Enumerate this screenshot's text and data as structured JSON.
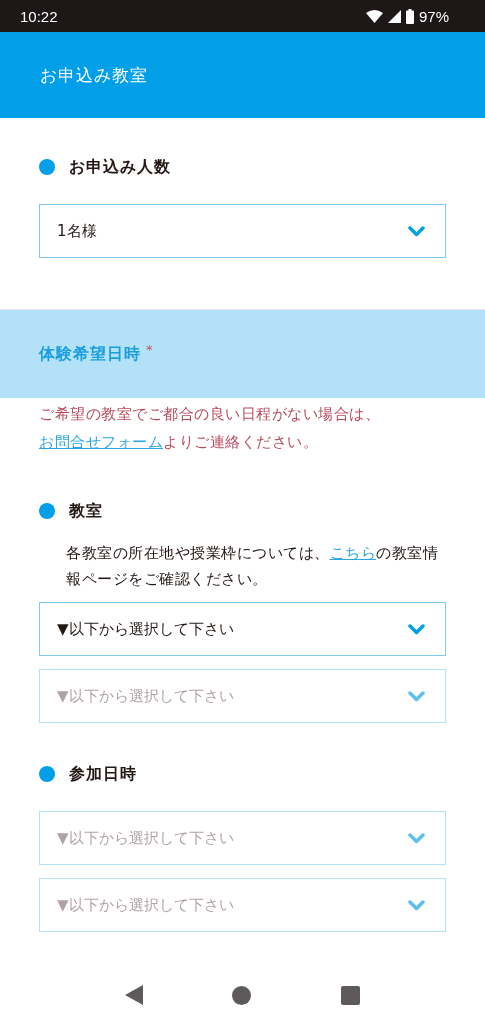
{
  "status_bar": {
    "time": "10:22",
    "battery": "97%"
  },
  "header": {
    "title": "お申込み教室"
  },
  "sections": [
    {
      "kind": "field",
      "label": "お申込み人数",
      "selects": [
        {
          "value": "1名様",
          "disabled": false
        }
      ]
    },
    {
      "kind": "band",
      "title": "体験希望日時",
      "required_mark": "*",
      "note": {
        "before": "ご希望の教室でご都合の良い日程がない場合は、",
        "link": "お問合せフォーム",
        "after": "よりご連絡ください。"
      }
    },
    {
      "kind": "field",
      "label": "教室",
      "description": {
        "before": "各教室の所在地や授業枠については、",
        "link": "こちら",
        "after": "の教室情報ページをご確認ください。"
      },
      "selects": [
        {
          "value": "▼以下から選択して下さい",
          "disabled": false
        },
        {
          "value": "▼以下から選択して下さい",
          "disabled": true
        }
      ]
    },
    {
      "kind": "field",
      "label": "参加日時",
      "selects": [
        {
          "value": "▼以下から選択して下さい",
          "disabled": true
        },
        {
          "value": "▼以下から選択して下さい",
          "disabled": true
        }
      ]
    }
  ]
}
